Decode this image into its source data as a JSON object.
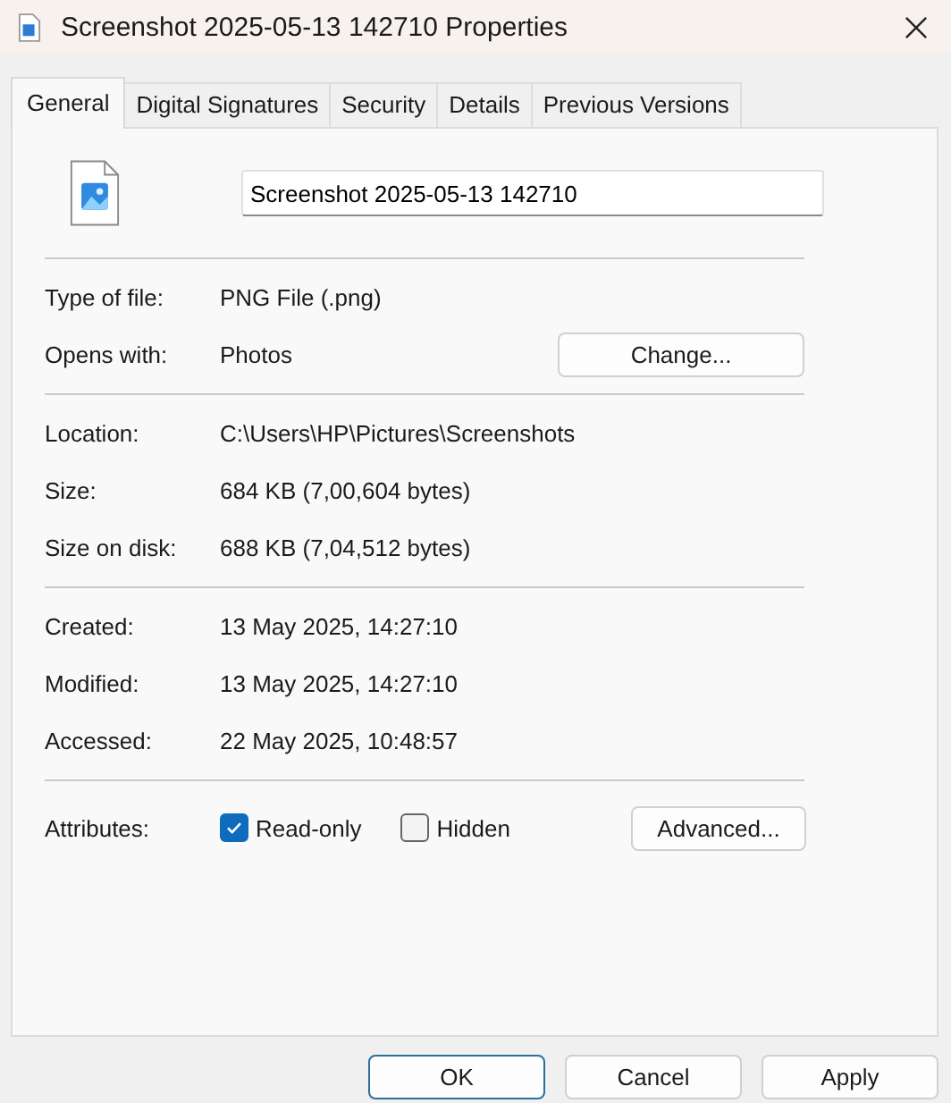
{
  "window": {
    "title": "Screenshot 2025-05-13 142710 Properties"
  },
  "tabs": [
    {
      "label": "General",
      "selected": true
    },
    {
      "label": "Digital Signatures",
      "selected": false
    },
    {
      "label": "Security",
      "selected": false
    },
    {
      "label": "Details",
      "selected": false
    },
    {
      "label": "Previous Versions",
      "selected": false
    }
  ],
  "file_name": {
    "value": "Screenshot 2025-05-13 142710"
  },
  "sections": [
    {
      "rows": [
        {
          "label": "Type of file:",
          "value": "PNG File (.png)"
        },
        {
          "label": "Opens with:",
          "value": "Photos",
          "button": "Change..."
        }
      ]
    },
    {
      "rows": [
        {
          "label": "Location:",
          "value": "C:\\Users\\HP\\Pictures\\Screenshots"
        },
        {
          "label": "Size:",
          "value": "684 KB (7,00,604 bytes)"
        },
        {
          "label": "Size on disk:",
          "value": "688 KB (7,04,512 bytes)"
        }
      ]
    },
    {
      "rows": [
        {
          "label": "Created:",
          "value": "13 May 2025, 14:27:10"
        },
        {
          "label": "Modified:",
          "value": "13 May 2025, 14:27:10"
        },
        {
          "label": "Accessed:",
          "value": "22 May 2025, 10:48:57"
        }
      ]
    }
  ],
  "attributes": {
    "label": "Attributes:",
    "checkboxes": [
      {
        "label": "Read-only",
        "checked": true
      },
      {
        "label": "Hidden",
        "checked": false
      }
    ],
    "button": "Advanced..."
  },
  "buttons": [
    {
      "label": "OK",
      "default": true
    },
    {
      "label": "Cancel",
      "default": false
    },
    {
      "label": "Apply",
      "default": false
    }
  ]
}
